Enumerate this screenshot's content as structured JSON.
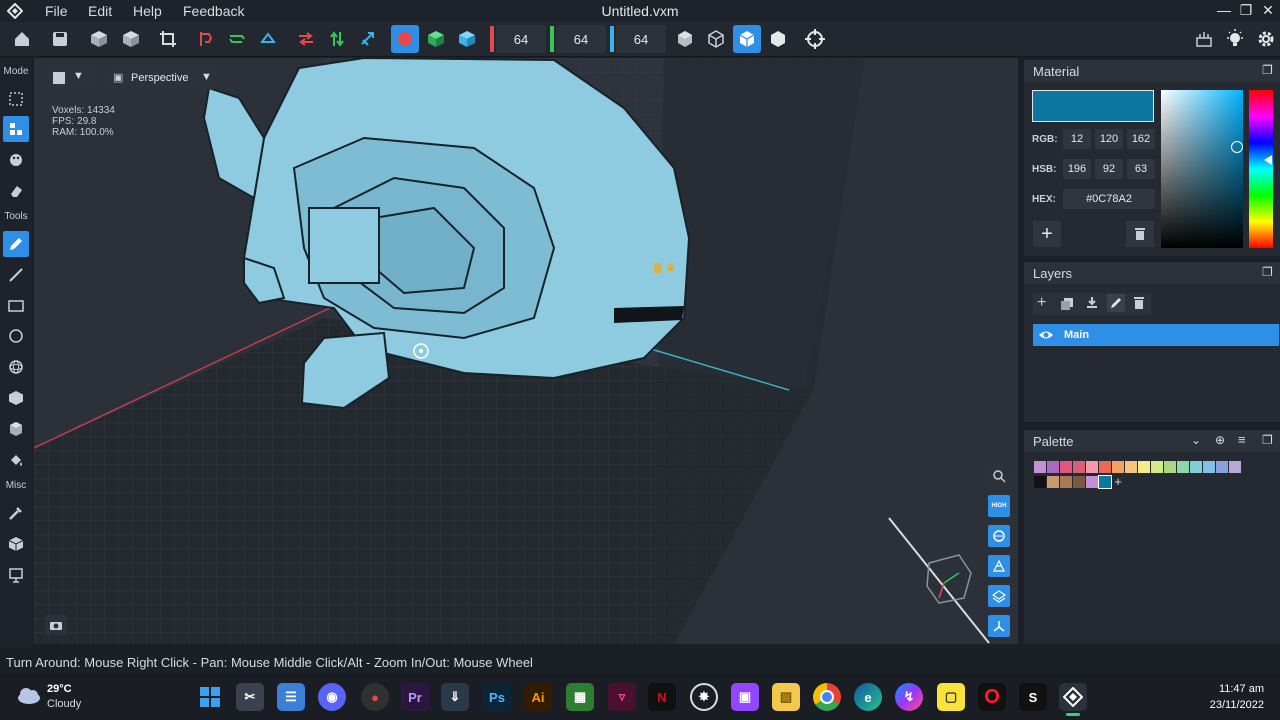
{
  "app": {
    "menu": [
      "File",
      "Edit",
      "Help",
      "Feedback"
    ],
    "title": "Untitled.vxm"
  },
  "toolbar": {
    "size_x": "64",
    "size_y": "64",
    "size_z": "64",
    "axis_colors": [
      "#e5484d",
      "#34c759",
      "#3ab4e8"
    ]
  },
  "sidebar": {
    "mode_label": "Mode",
    "tools_label": "Tools",
    "misc_label": "Misc"
  },
  "viewport": {
    "camera_mode": "Perspective",
    "stats": {
      "voxels": "Voxels: 14334",
      "fps": "FPS: 29.8",
      "ram": "RAM: 100.0%"
    },
    "quality_label": "HIGH"
  },
  "material": {
    "title": "Material",
    "color": "#0C78A2",
    "rgb_label": "RGB:",
    "rgb": [
      "12",
      "120",
      "162"
    ],
    "hsb_label": "HSB:",
    "hsb": [
      "196",
      "92",
      "63"
    ],
    "hex_label": "HEX:",
    "hex": "#0C78A2"
  },
  "layers": {
    "title": "Layers",
    "items": [
      {
        "name": "Main",
        "selected": true
      }
    ]
  },
  "palette": {
    "title": "Palette",
    "row1": [
      "#c58fd6",
      "#a86bc0",
      "#e2587d",
      "#d6607a",
      "#f49aa9",
      "#e8685a",
      "#f0a261",
      "#f6c77a",
      "#f5ec8a",
      "#d4ea8a",
      "#a8d87f",
      "#8ed8a7",
      "#7fd0d6",
      "#7fbfe8",
      "#8aa0d8",
      "#b9a7d9"
    ],
    "row2": [
      "#121212",
      "#c79a6f",
      "#a87a54",
      "#7a5a3c",
      "#c58fd6",
      "#0c78a2"
    ]
  },
  "status_hint": "Turn Around: Mouse Right Click - Pan: Mouse Middle Click/Alt - Zoom In/Out: Mouse Wheel",
  "taskbar": {
    "temperature": "29°C",
    "weather": "Cloudy",
    "time": "11:47 am",
    "date": "23/11/2022"
  }
}
